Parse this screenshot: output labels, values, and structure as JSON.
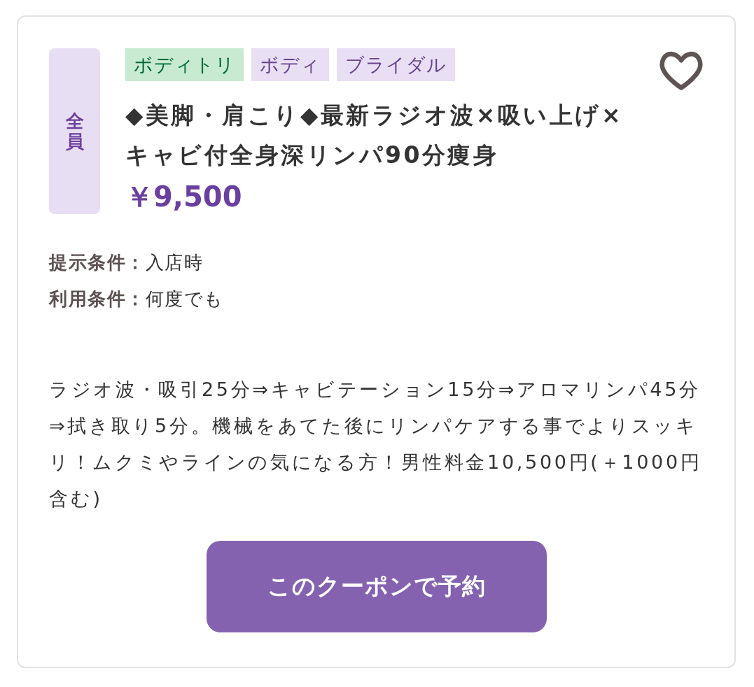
{
  "coupon": {
    "audience_badge": "全員",
    "tags": [
      {
        "label": "ボディトリ",
        "color": "#c8ead0"
      },
      {
        "label": "ボディ",
        "color": "#e8dff4"
      },
      {
        "label": "ブライダル",
        "color": "#e8dff4"
      }
    ],
    "favorite": {
      "on": false
    },
    "title": "◆美脚・肩こり◆最新ラジオ波×吸い上げ×キャビ付全身深リンパ90分痩身",
    "price": "￥9,500",
    "conditions": [
      {
        "label": "提示条件：",
        "value": "入店時"
      },
      {
        "label": "利用条件：",
        "value": "何度でも"
      }
    ],
    "description": "ラジオ波・吸引25分⇒キャビテーション15分⇒アロマリンパ45分⇒拭き取り5分。機械をあてた後にリンパケアする事でよりスッキリ！ムクミやラインの気になる方！男性料金10,500円(＋1000円含む)",
    "reserve_button": "このクーポンで予約"
  }
}
